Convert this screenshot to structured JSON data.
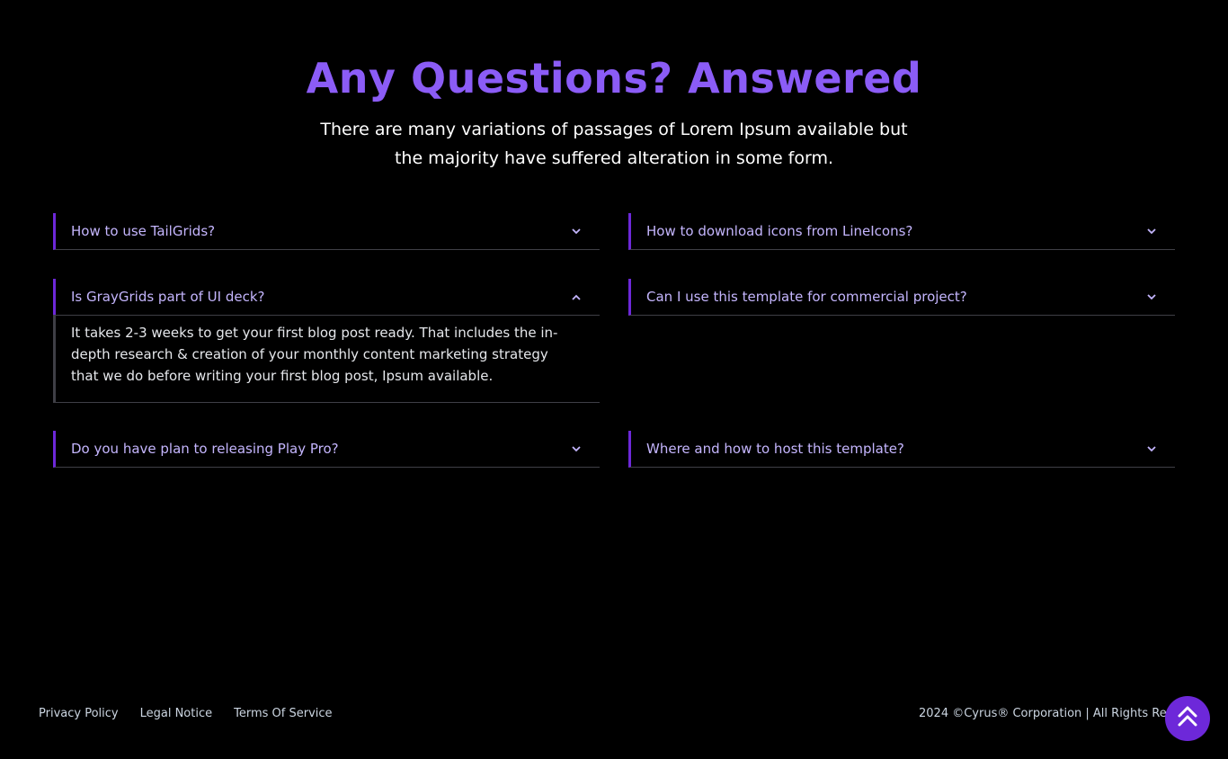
{
  "hero": {
    "title": "Any Questions? Answered",
    "subtitle": "There are many variations of passages of Lorem Ipsum available but the majority have suffered alteration in some form."
  },
  "faq": {
    "left": [
      {
        "question": "How to use TailGrids?",
        "open": false,
        "icon": "chevron-down-icon"
      },
      {
        "question": "Is GrayGrids part of UI deck?",
        "open": true,
        "icon": "chevron-up-icon",
        "answer": "It takes 2-3 weeks to get your first blog post ready. That includes the in-depth research & creation of your monthly content marketing strategy that we do before writing your first blog post, Ipsum available."
      },
      {
        "question": "Do you have plan to releasing Play Pro?",
        "open": false,
        "icon": "chevron-down-icon"
      }
    ],
    "right": [
      {
        "question": "How to download icons from LineIcons?",
        "open": false,
        "icon": "chevron-down-icon"
      },
      {
        "question": "Can I use this template for commercial project?",
        "open": false,
        "icon": "chevron-down-icon"
      },
      {
        "question": "Where and how to host this template?",
        "open": false,
        "icon": "chevron-down-icon"
      }
    ]
  },
  "footer": {
    "links": [
      "Privacy Policy",
      "Legal Notice",
      "Terms Of Service"
    ],
    "copyright": "2024 ©Cyrus® Corporation | All Rights Reserved"
  },
  "scroll_top": {
    "icon": "double-chevron-up-icon"
  },
  "colors": {
    "accent": "#8b5cf6",
    "accent_dark": "#6d28d9",
    "question_text": "#c4b5fd",
    "background": "#000000"
  }
}
